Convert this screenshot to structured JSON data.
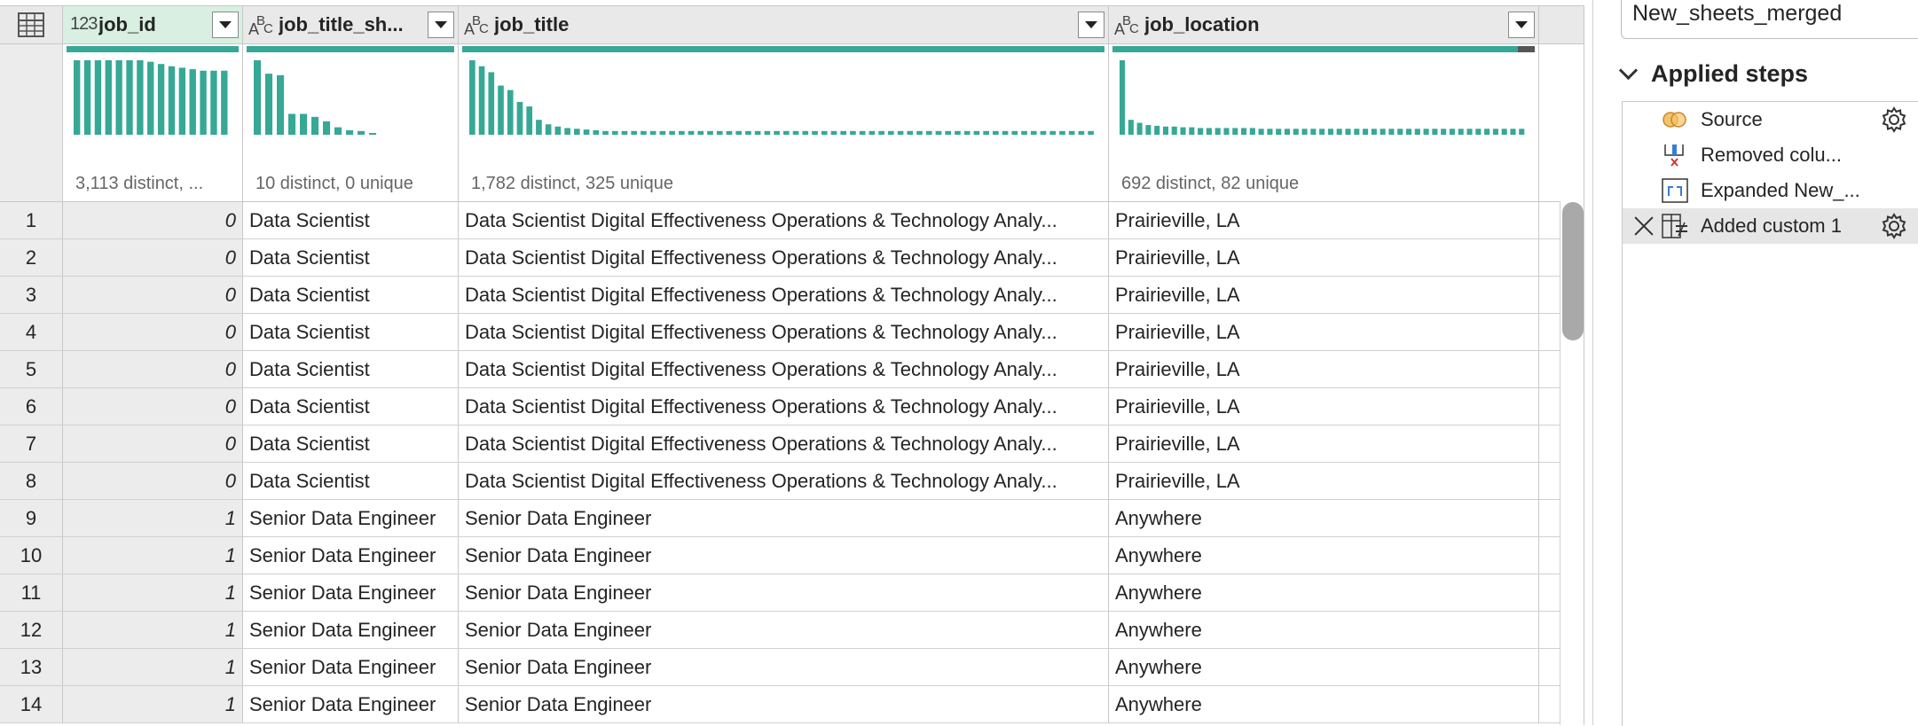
{
  "grid": {
    "columns": [
      {
        "name": "job_id",
        "type": "whole-number-icon",
        "type_label": "123",
        "profile": "3,113 distinct, ..."
      },
      {
        "name": "job_title_sh...",
        "type": "text-icon",
        "type_label": "ABC",
        "profile": "10 distinct, 0 unique"
      },
      {
        "name": "job_title",
        "type": "text-icon",
        "type_label": "ABC",
        "profile": "1,782 distinct, 325 unique"
      },
      {
        "name": "job_location",
        "type": "text-icon",
        "type_label": "ABC",
        "profile": "692 distinct, 82 unique"
      }
    ],
    "histograms": [
      [
        100,
        100,
        100,
        100,
        100,
        100,
        100,
        98,
        95,
        92,
        90,
        88,
        86,
        86,
        86
      ],
      [
        100,
        82,
        80,
        28,
        28,
        24,
        18,
        10,
        6,
        5,
        2
      ],
      [
        100,
        92,
        84,
        66,
        60,
        44,
        38,
        20,
        14,
        11,
        9,
        8,
        7,
        6,
        5,
        5,
        5,
        5,
        5,
        5,
        5,
        5,
        5,
        5,
        5,
        5,
        5,
        5,
        5,
        5,
        5,
        5,
        5,
        5,
        5,
        5,
        5,
        5,
        5,
        5,
        5,
        5,
        5,
        5,
        5,
        5,
        5,
        5,
        5,
        5,
        5,
        5,
        5,
        5,
        5,
        5,
        5,
        5,
        5,
        5,
        5,
        5,
        5,
        5,
        5,
        5
      ],
      [
        100,
        20,
        16,
        13,
        12,
        11,
        11,
        10,
        10,
        9,
        9,
        9,
        9,
        9,
        9,
        9,
        8,
        8,
        8,
        8,
        8,
        8,
        8,
        8,
        8,
        8,
        8,
        8,
        8,
        8,
        8,
        8,
        8,
        8,
        8,
        8,
        8,
        8,
        8,
        8,
        8,
        8,
        8,
        8,
        8,
        8,
        8
      ]
    ],
    "quality_error_fraction": [
      0,
      0,
      0,
      0.04
    ],
    "rows": [
      [
        "1",
        "0",
        "Data Scientist",
        "Data Scientist Digital Effectiveness Operations & Technology Analy...",
        "Prairieville, LA"
      ],
      [
        "2",
        "0",
        "Data Scientist",
        "Data Scientist Digital Effectiveness Operations & Technology Analy...",
        "Prairieville, LA"
      ],
      [
        "3",
        "0",
        "Data Scientist",
        "Data Scientist Digital Effectiveness Operations & Technology Analy...",
        "Prairieville, LA"
      ],
      [
        "4",
        "0",
        "Data Scientist",
        "Data Scientist Digital Effectiveness Operations & Technology Analy...",
        "Prairieville, LA"
      ],
      [
        "5",
        "0",
        "Data Scientist",
        "Data Scientist Digital Effectiveness Operations & Technology Analy...",
        "Prairieville, LA"
      ],
      [
        "6",
        "0",
        "Data Scientist",
        "Data Scientist Digital Effectiveness Operations & Technology Analy...",
        "Prairieville, LA"
      ],
      [
        "7",
        "0",
        "Data Scientist",
        "Data Scientist Digital Effectiveness Operations & Technology Analy...",
        "Prairieville, LA"
      ],
      [
        "8",
        "0",
        "Data Scientist",
        "Data Scientist Digital Effectiveness Operations & Technology Analy...",
        "Prairieville, LA"
      ],
      [
        "9",
        "1",
        "Senior Data Engineer",
        "Senior Data Engineer",
        "Anywhere"
      ],
      [
        "10",
        "1",
        "Senior Data Engineer",
        "Senior Data Engineer",
        "Anywhere"
      ],
      [
        "11",
        "1",
        "Senior Data Engineer",
        "Senior Data Engineer",
        "Anywhere"
      ],
      [
        "12",
        "1",
        "Senior Data Engineer",
        "Senior Data Engineer",
        "Anywhere"
      ],
      [
        "13",
        "1",
        "Senior Data Engineer",
        "Senior Data Engineer",
        "Anywhere"
      ],
      [
        "14",
        "1",
        "Senior Data Engineer",
        "Senior Data Engineer",
        "Anywhere"
      ]
    ]
  },
  "pane": {
    "query_name": "New_sheets_merged",
    "steps_title": "Applied steps",
    "steps": [
      {
        "label": "Source",
        "icon": "source-icon",
        "has_settings": true,
        "active": false
      },
      {
        "label": "Removed colu...",
        "icon": "removed-columns-icon",
        "has_settings": false,
        "active": false
      },
      {
        "label": "Expanded New_...",
        "icon": "expand-icon",
        "has_settings": false,
        "active": false
      },
      {
        "label": "Added custom 1",
        "icon": "custom-column-icon",
        "has_settings": true,
        "active": true
      }
    ]
  },
  "colors": {
    "accent": "#36a896",
    "error": "#555555",
    "selected_header": "#d8efe2"
  }
}
